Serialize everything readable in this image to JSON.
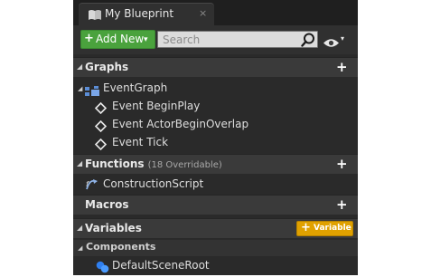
{
  "tab": {
    "title": "My Blueprint",
    "close": "×",
    "icon": "book-icon"
  },
  "toolbar": {
    "add_new_label": "Add New",
    "add_new_plus": "+",
    "add_new_caret": "▾",
    "search_placeholder": "Search",
    "eye_caret": "▾"
  },
  "sections": {
    "graphs": {
      "title": "Graphs",
      "plus": "+",
      "event_graph": "EventGraph",
      "events": [
        "Event BeginPlay",
        "Event ActorBeginOverlap",
        "Event Tick"
      ]
    },
    "functions": {
      "title": "Functions",
      "subtitle": "(18 Overridable)",
      "plus": "+",
      "items": [
        "ConstructionScript"
      ]
    },
    "macros": {
      "title": "Macros",
      "plus": "+"
    },
    "variables": {
      "title": "Variables",
      "button_plus": "+",
      "button_label": "Variable"
    },
    "components": {
      "title": "Components",
      "items": [
        "DefaultSceneRoot"
      ]
    }
  },
  "arrows": {
    "expanded": "◢"
  },
  "colors": {
    "panel_bg": "#2a2a2a",
    "header_bg": "#3a3a3a",
    "add_new_green": "#4aa23d",
    "variable_orange": "#e0a100",
    "event_graph_blue": "#5b8dd6",
    "function_icon": "#8fb3e6",
    "component_blue": "#2f7ff0"
  }
}
